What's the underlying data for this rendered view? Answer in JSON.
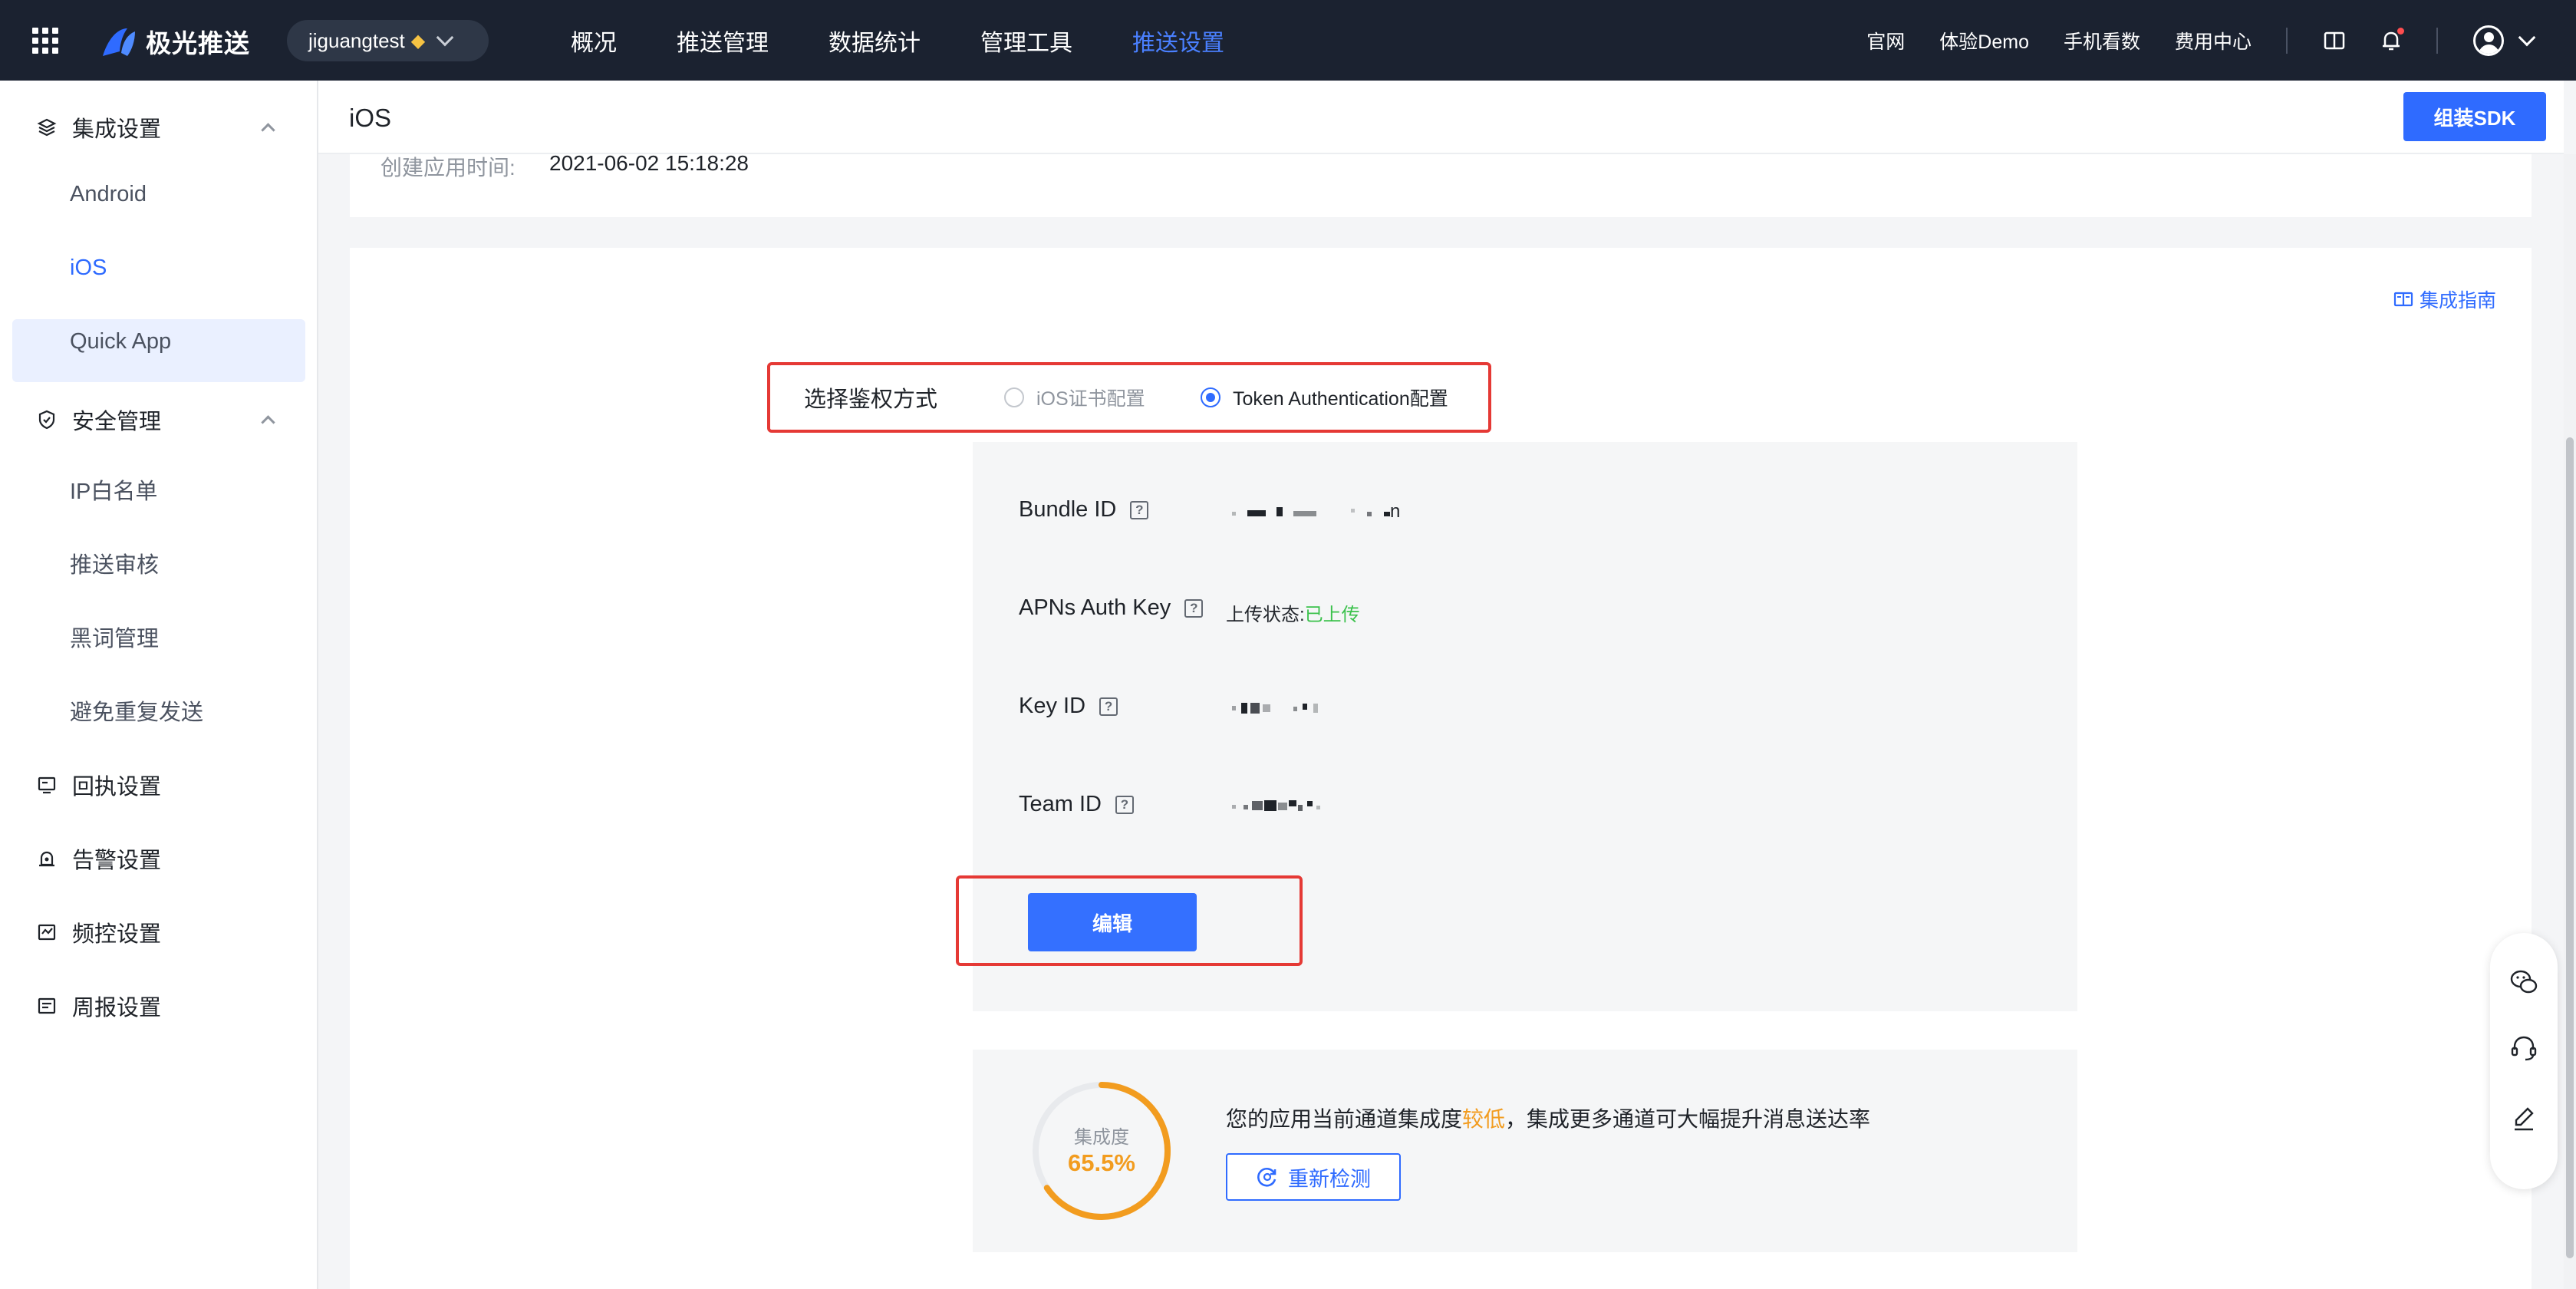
{
  "topbar": {
    "brand": "极光推送",
    "app_name": "jiguangtest",
    "nav": [
      "概况",
      "推送管理",
      "数据统计",
      "管理工具",
      "推送设置"
    ],
    "active_nav": "推送设置",
    "links": [
      "官网",
      "体验Demo",
      "手机看数",
      "费用中心"
    ]
  },
  "sidebar": {
    "groups": [
      {
        "label": "集成设置",
        "icon": "layers-icon",
        "items": [
          "Android",
          "iOS",
          "Quick App"
        ]
      },
      {
        "label": "安全管理",
        "icon": "shield-icon",
        "items": [
          "IP白名单",
          "推送审核",
          "黑词管理",
          "避免重复发送"
        ]
      },
      {
        "label": "回执设置",
        "icon": "receipt-icon"
      },
      {
        "label": "告警设置",
        "icon": "alarm-icon"
      },
      {
        "label": "频控设置",
        "icon": "frequency-icon"
      },
      {
        "label": "周报设置",
        "icon": "report-icon"
      }
    ],
    "active_item": "iOS"
  },
  "page": {
    "title": "iOS",
    "sdk_button": "组装SDK",
    "created_label": "创建应用时间:",
    "created_value": "2021-06-02 15:18:28",
    "guide_link": "集成指南"
  },
  "auth": {
    "label": "选择鉴权方式",
    "options": [
      "iOS证书配置",
      "Token Authentication配置"
    ],
    "selected": "Token Authentication配置"
  },
  "form": {
    "fields": [
      {
        "label": "Bundle ID",
        "value_suffix": "n"
      },
      {
        "label": "APNs Auth Key"
      },
      {
        "label": "Key ID"
      },
      {
        "label": "Team ID"
      }
    ],
    "upload_status_label": "上传状态:",
    "upload_status_value": "已上传",
    "edit_button": "编辑",
    "help_glyph": "?"
  },
  "integration": {
    "score_label": "集成度",
    "score_value": "65.5%",
    "score_percent": 65.5,
    "message_prefix": "您的应用当前通道集成度",
    "message_highlight": "较低",
    "message_suffix": "，集成更多通道可大幅提升消息送达率",
    "recheck_button": "重新检测"
  },
  "colors": {
    "brand_blue": "#2f6bff",
    "highlight_red": "#e53935",
    "success_green": "#3ac14b",
    "warning_orange": "#f29c1f",
    "topbar_bg": "#1b2230"
  }
}
